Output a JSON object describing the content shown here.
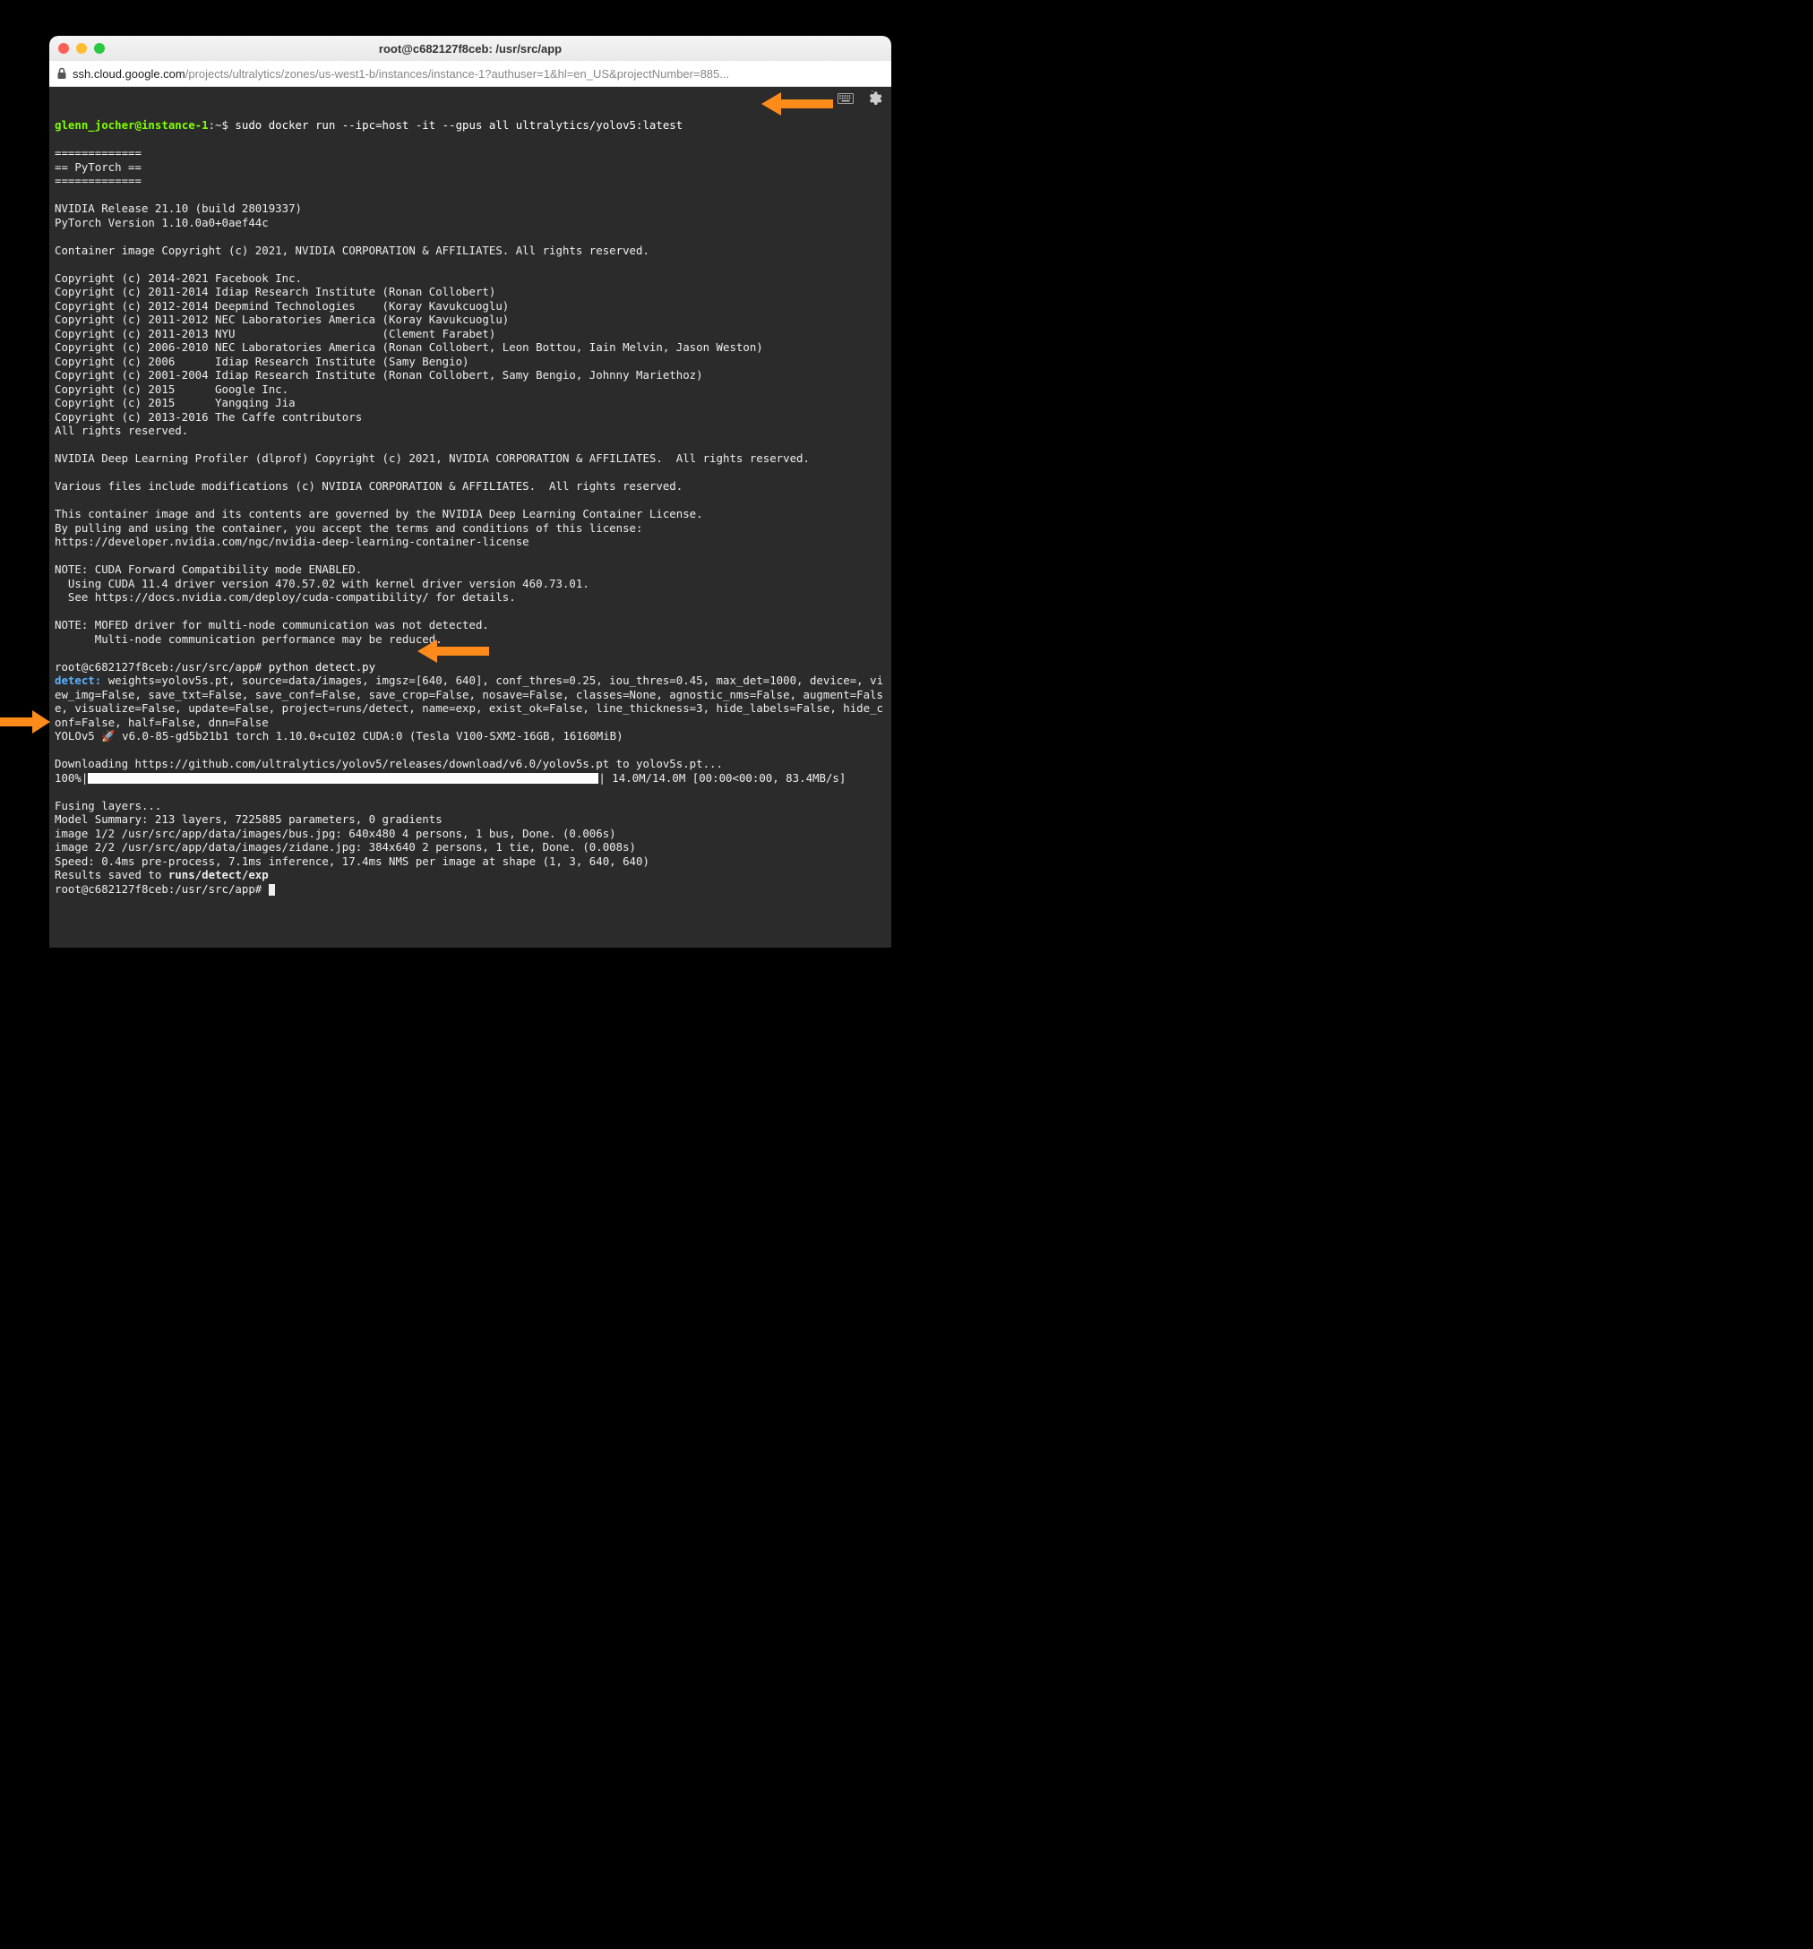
{
  "window": {
    "title": "root@c682127f8ceb: /usr/src/app"
  },
  "url": {
    "host": "ssh.cloud.google.com",
    "path": "/projects/ultralytics/zones/us-west1-b/instances/instance-1?authuser=1&hl=en_US&projectNumber=885..."
  },
  "prompt1": {
    "user": "glenn_jocher@instance-1",
    "sep": ":~$ ",
    "cmd": "sudo docker run --ipc=host -it --gpus all ultralytics/yolov5:latest"
  },
  "banner": {
    "sep": "=============",
    "mid": "== PyTorch =="
  },
  "nvidia": {
    "release": "NVIDIA Release 21.10 (build 28019337)",
    "pytorch": "PyTorch Version 1.10.0a0+0aef44c",
    "copyright": "Container image Copyright (c) 2021, NVIDIA CORPORATION & AFFILIATES. All rights reserved."
  },
  "copyrights": [
    "Copyright (c) 2014-2021 Facebook Inc.",
    "Copyright (c) 2011-2014 Idiap Research Institute (Ronan Collobert)",
    "Copyright (c) 2012-2014 Deepmind Technologies    (Koray Kavukcuoglu)",
    "Copyright (c) 2011-2012 NEC Laboratories America (Koray Kavukcuoglu)",
    "Copyright (c) 2011-2013 NYU                      (Clement Farabet)",
    "Copyright (c) 2006-2010 NEC Laboratories America (Ronan Collobert, Leon Bottou, Iain Melvin, Jason Weston)",
    "Copyright (c) 2006      Idiap Research Institute (Samy Bengio)",
    "Copyright (c) 2001-2004 Idiap Research Institute (Ronan Collobert, Samy Bengio, Johnny Mariethoz)",
    "Copyright (c) 2015      Google Inc.",
    "Copyright (c) 2015      Yangqing Jia",
    "Copyright (c) 2013-2016 The Caffe contributors",
    "All rights reserved."
  ],
  "dlprof": "NVIDIA Deep Learning Profiler (dlprof) Copyright (c) 2021, NVIDIA CORPORATION & AFFILIATES.  All rights reserved.",
  "various": "Various files include modifications (c) NVIDIA CORPORATION & AFFILIATES.  All rights reserved.",
  "license": [
    "This container image and its contents are governed by the NVIDIA Deep Learning Container License.",
    "By pulling and using the container, you accept the terms and conditions of this license:",
    "https://developer.nvidia.com/ngc/nvidia-deep-learning-container-license"
  ],
  "note_cuda": [
    "NOTE: CUDA Forward Compatibility mode ENABLED.",
    "  Using CUDA 11.4 driver version 470.57.02 with kernel driver version 460.73.01.",
    "  See https://docs.nvidia.com/deploy/cuda-compatibility/ for details."
  ],
  "note_mofed": [
    "NOTE: MOFED driver for multi-node communication was not detected.",
    "      Multi-node communication performance may be reduced."
  ],
  "prompt2": {
    "user": "root@c682127f8ceb:/usr/src/app# ",
    "cmd": "python detect.py"
  },
  "detect": {
    "label": "detect: ",
    "params": "weights=yolov5s.pt, source=data/images, imgsz=[640, 640], conf_thres=0.25, iou_thres=0.45, max_det=1000, device=, view_img=False, save_txt=False, save_conf=False, save_crop=False, nosave=False, classes=None, agnostic_nms=False, augment=False, visualize=False, update=False, project=runs/detect, name=exp, exist_ok=False, line_thickness=3, hide_labels=False, hide_conf=False, half=False, dnn=False"
  },
  "yolo_line": "YOLOv5 🚀 v6.0-85-gd5b21b1 torch 1.10.0+cu102 CUDA:0 (Tesla V100-SXM2-16GB, 16160MiB)",
  "download": "Downloading https://github.com/ultralytics/yolov5/releases/download/v6.0/yolov5s.pt to yolov5s.pt...",
  "progress": {
    "pct": "100%",
    "stats": "| 14.0M/14.0M [00:00<00:00, 83.4MB/s]"
  },
  "fusing": "Fusing layers...",
  "summary": "Model Summary: 213 layers, 7225885 parameters, 0 gradients",
  "img1": "image 1/2 /usr/src/app/data/images/bus.jpg: 640x480 4 persons, 1 bus, Done. (0.006s)",
  "img2": "image 2/2 /usr/src/app/data/images/zidane.jpg: 384x640 2 persons, 1 tie, Done. (0.008s)",
  "speed": "Speed: 0.4ms pre-process, 7.1ms inference, 17.4ms NMS per image at shape (1, 3, 640, 640)",
  "results_prefix": "Results saved to ",
  "results_path": "runs/detect/exp",
  "prompt3": "root@c682127f8ceb:/usr/src/app# "
}
